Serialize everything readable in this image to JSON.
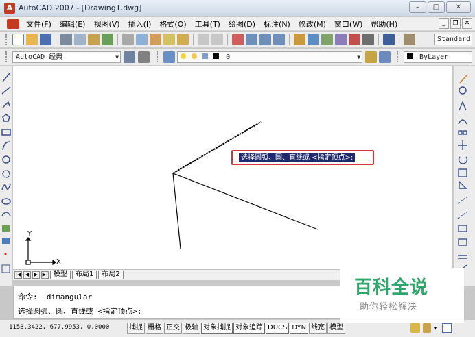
{
  "window": {
    "title": "AutoCAD 2007 - [Drawing1.dwg]",
    "controls": [
      "–",
      "□",
      "✕"
    ]
  },
  "menu": {
    "items": [
      "文件(F)",
      "编辑(E)",
      "视图(V)",
      "插入(I)",
      "格式(O)",
      "工具(T)",
      "绘图(D)",
      "标注(N)",
      "修改(M)",
      "窗口(W)",
      "帮助(H)"
    ],
    "mdi_controls": [
      "_",
      "❐",
      "✕"
    ]
  },
  "toolbar": {
    "text_style": "Standard",
    "workspace": "AutoCAD 经典",
    "layer": "0",
    "color": "ByLayer"
  },
  "canvas": {
    "tooltip": "选择圆弧、圆、直线或 <指定顶点>:",
    "ucs_x": "X",
    "ucs_y": "Y"
  },
  "tabs": {
    "items": [
      "模型",
      "布局1",
      "布局2"
    ]
  },
  "command": {
    "line1": "命令: _dimangular",
    "line2": "选择圆弧、圆、直线或 <指定顶点>:"
  },
  "status": {
    "coordinates": "1153.3422, 677.9953, 0.0000",
    "buttons": [
      "捕捉",
      "栅格",
      "正交",
      "极轴",
      "对象捕捉",
      "对象追踪",
      "DUCS",
      "DYN",
      "线宽",
      "模型"
    ]
  },
  "watermark": {
    "title": "百科全说",
    "subtitle": "助你轻松解决"
  }
}
